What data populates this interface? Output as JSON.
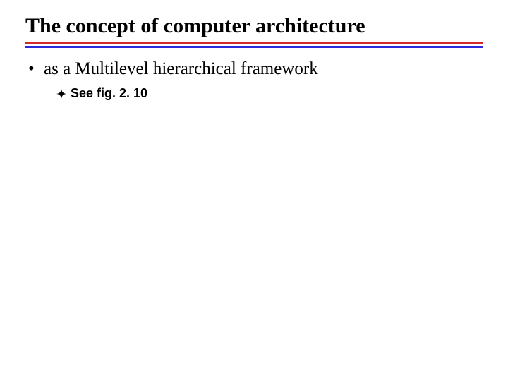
{
  "title": "The concept of computer architecture",
  "bullets": {
    "level1": {
      "marker": "•",
      "text": "as a Multilevel hierarchical framework"
    },
    "level2": {
      "icon": "four-point-diamond-icon",
      "text": "See fig. 2. 10"
    }
  },
  "colors": {
    "rule_red": "#d22a2a",
    "rule_blue": "#2b2bdc"
  }
}
